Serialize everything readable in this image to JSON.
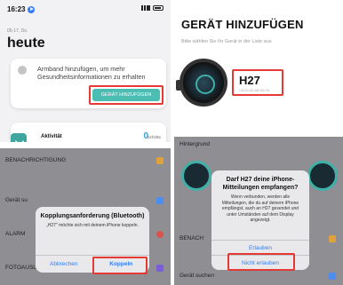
{
  "panel1": {
    "time": "16:23",
    "date": "05-17, Do.",
    "heading": "heute",
    "card_text": "Armband hinzufügen, um mehr Gesundheitsinformationen zu erhalten",
    "add_button": "GERÄT HINZUFÜGEN",
    "activity_label": "Aktivität",
    "activity_count": "0",
    "activity_unit": "Schritte"
  },
  "panel2": {
    "title": "GERÄT HINZUFÜGEN",
    "subtitle": "Bitte wählen Sie Ihr Gerät in der Liste aus",
    "device_name": "H27",
    "device_mac": "C8:00:00:AB:00:F8"
  },
  "panel3": {
    "rows": [
      "BENACHRICHTIGUNG",
      "Gerät su",
      "ALARM",
      "FOTOAUSLÖSER"
    ],
    "dialog_title": "Kopplungsanforderung (Bluetooth)",
    "dialog_message": "„H27\" möchte sich mit deinem iPhone koppeln.",
    "cancel": "Abbrechen",
    "pair": "Koppeln"
  },
  "panel4": {
    "section": "Hintergrund",
    "dialog_title": "Darf H27 deine iPhone-Mitteilungen empfangen?",
    "dialog_message": "Wenn verbunden, werden alle Mitteilungen, die du auf deinem iPhone empfängst, auch an H27 gesendet und unter Umständen auf dem Display angezeigt.",
    "allow": "Erlauben",
    "deny": "Nicht erlauben",
    "row_benach": "BENACH",
    "row_search": "Gerät suchen"
  },
  "colors": {
    "accent": "#4bbdb3",
    "highlight": "#e53935",
    "ios_blue": "#2f7cf6"
  }
}
